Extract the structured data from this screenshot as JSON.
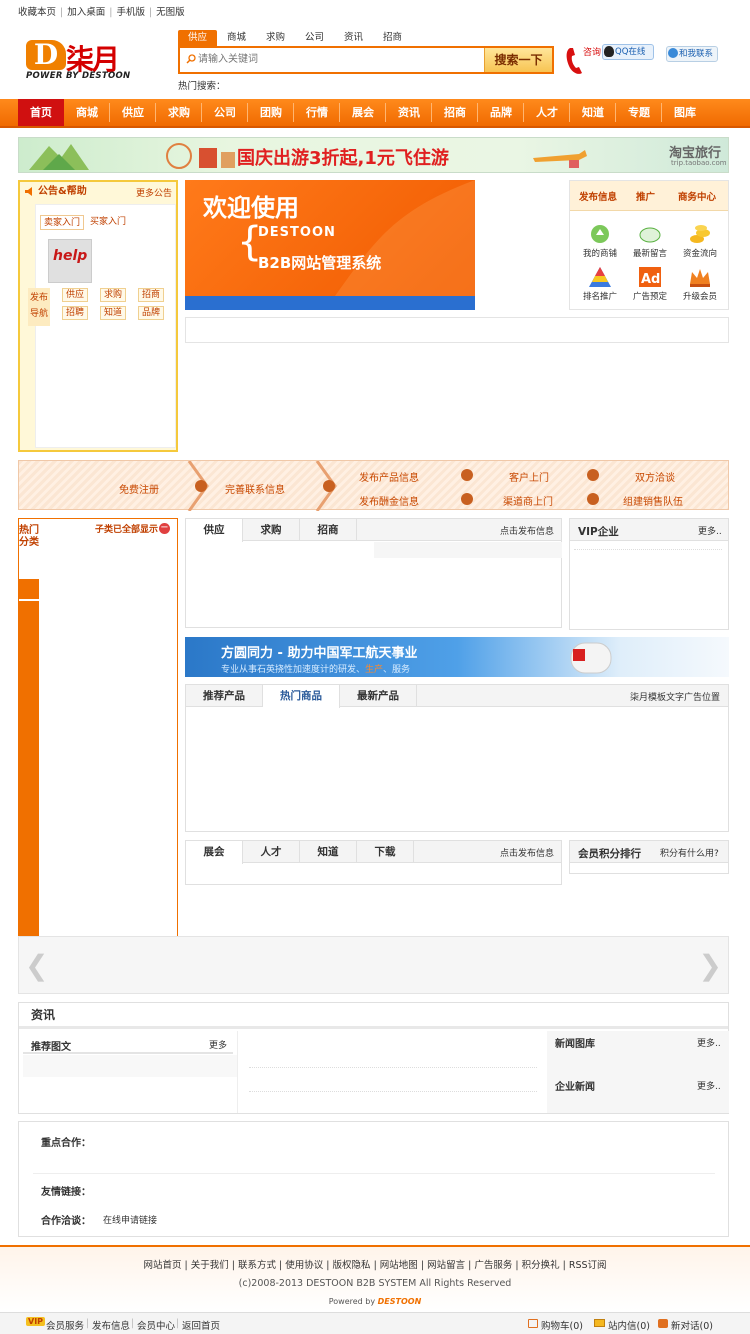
{
  "toplinks": [
    "收藏本页",
    "加入桌面",
    "手机版",
    "无图版"
  ],
  "logo": {
    "mark": "D",
    "text": "柒月",
    "sub": "POWER BY DESTOON"
  },
  "search": {
    "tabs": [
      "供应",
      "商城",
      "求购",
      "公司",
      "资讯",
      "招商"
    ],
    "placeholder": "请输入关键词",
    "button": "搜索一下",
    "hot_label": "热门搜索："
  },
  "contact": {
    "consult": "咨询",
    "qq": "QQ在线",
    "contact_us": "和我联系"
  },
  "nav": [
    "首页",
    "商城",
    "供应",
    "求购",
    "公司",
    "团购",
    "行情",
    "展会",
    "资讯",
    "招商",
    "品牌",
    "人才",
    "知道",
    "专题",
    "图库"
  ],
  "banner_top": {
    "text": "国庆出游3折起,1元飞住游",
    "brand": "淘宝旅行",
    "brand_url": "trip.taobao.com"
  },
  "notice": {
    "title": "公告&帮助",
    "more": "更多公告",
    "tabs": [
      "卖家入门",
      "买家入门"
    ],
    "help": "help",
    "pub_label": "发布导航",
    "pub_items": [
      "供应",
      "求购",
      "招商",
      "招聘",
      "知道",
      "品牌"
    ]
  },
  "welcome": {
    "line1": "欢迎使用",
    "line2": "DESTOON",
    "line3": "B2B网站管理系统"
  },
  "quick": {
    "tabs": [
      "发布信息",
      "推广",
      "商务中心"
    ],
    "items": [
      "我的商铺",
      "最新留言",
      "资金流向",
      "排名推广",
      "广告预定",
      "升级会员"
    ]
  },
  "steps": {
    "s1": "免费注册",
    "s2": "完善联系信息",
    "top": [
      "发布产品信息",
      "客户上门",
      "双方洽谈"
    ],
    "bottom": [
      "发布酬金信息",
      "渠道商上门",
      "组建销售队伍"
    ]
  },
  "hotcat": {
    "label": "热门分类",
    "right": "子类已全部显示"
  },
  "supply_panel": {
    "tabs": [
      "供应",
      "求购",
      "招商"
    ],
    "link": "点击发布信息"
  },
  "vip": {
    "title": "VIP企业",
    "more": "更多.."
  },
  "banner2": {
    "title": "方圆同力 - 助力中国军工航天事业",
    "sub_a": "专业从事石英挠性加速度计的研发、",
    "sub_b": "生产",
    "sub_c": "、服务"
  },
  "product_panel": {
    "tabs": [
      "推荐产品",
      "热门商品",
      "最新产品"
    ],
    "link": "柒月模板文字广告位置"
  },
  "expo_panel": {
    "tabs": [
      "展会",
      "人才",
      "知道",
      "下载"
    ],
    "link": "点击发布信息"
  },
  "rank": {
    "title": "会员积分排行",
    "link": "积分有什么用?"
  },
  "news": {
    "title": "资讯",
    "pic_title": "推荐图文",
    "pic_more": "更多",
    "gallery": "新闻图库",
    "gallery_more": "更多..",
    "corp": "企业新闻",
    "corp_more": "更多.."
  },
  "partners": {
    "key": "重点合作：",
    "friend": "友情链接：",
    "coop": "合作洽谈：",
    "apply": "在线申请链接"
  },
  "footer": {
    "links": [
      "网站首页",
      "关于我们",
      "联系方式",
      "使用协议",
      "版权隐私",
      "网站地图",
      "网站留言",
      "广告服务",
      "积分换礼",
      "RSS订阅"
    ],
    "copyright": "(c)2008-2013 DESTOON B2B SYSTEM All Rights Reserved",
    "powered": "Powered by",
    "powered_brand": "DESTOON"
  },
  "bottombar": {
    "vip": "VIP",
    "left": [
      "会员服务",
      "发布信息",
      "会员中心",
      "返回首页"
    ],
    "cart": "购物车(0)",
    "mail": "站内信(0)",
    "chat": "新对话(0)"
  },
  "colors": {
    "accent": "#f07000",
    "nav_active": "#d01010",
    "brand_red": "#d40000"
  }
}
